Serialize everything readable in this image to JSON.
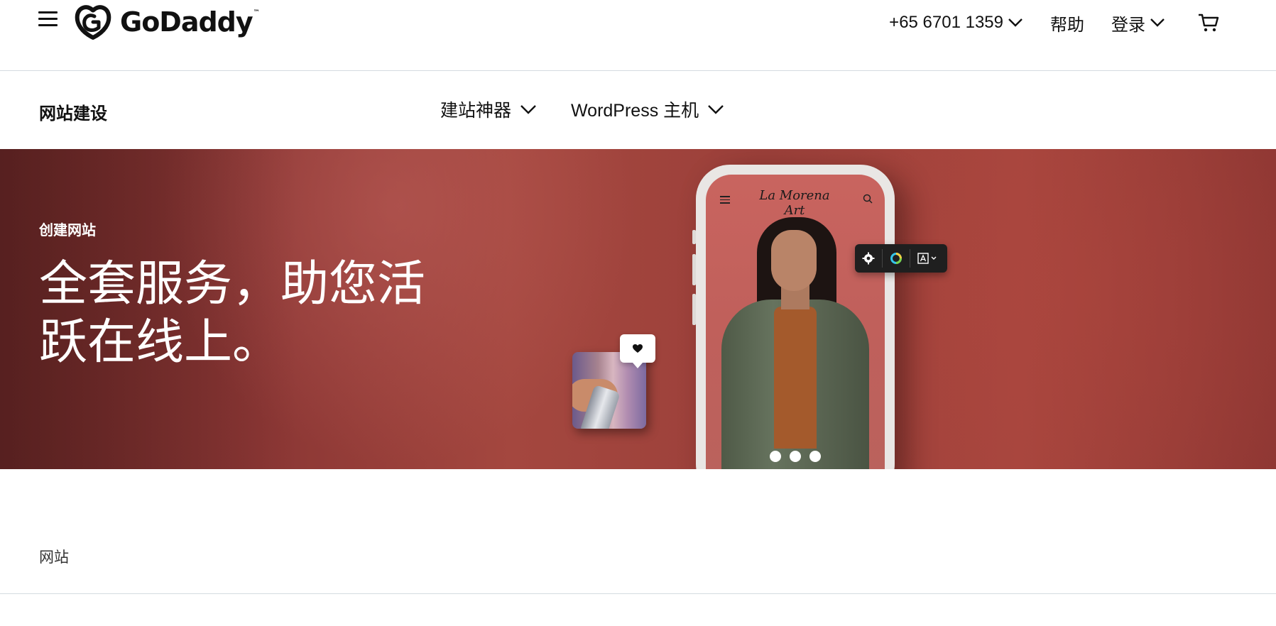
{
  "header": {
    "logo_text": "GoDaddy",
    "logo_tm": "™",
    "phone": "+65 6701 1359",
    "help": "帮助",
    "login": "登录"
  },
  "subnav": {
    "title": "网站建设",
    "items": [
      {
        "label": "建站神器"
      },
      {
        "label": "WordPress 主机"
      }
    ]
  },
  "hero": {
    "eyebrow": "创建网站",
    "headline": "全套服务，助您活跃在线上。",
    "phone_mockup": {
      "brand": "La Morena Art"
    }
  },
  "section": {
    "breadcrumb": "网站"
  },
  "colors": {
    "hero_bg": "#a4473f",
    "text": "#111111",
    "divider": "#d4dbe0"
  },
  "icons": {
    "menu": "hamburger-icon",
    "cart": "cart-icon",
    "chevron": "chevron-down-icon",
    "settings": "gear-icon",
    "color": "color-wheel-icon",
    "font": "font-icon",
    "heart": "heart-icon"
  }
}
